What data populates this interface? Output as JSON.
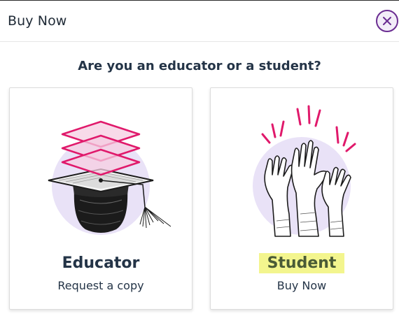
{
  "header": {
    "title": "Buy Now",
    "close_icon": "close-icon"
  },
  "question": "Are you an educator or a student?",
  "cards": [
    {
      "title": "Educator",
      "subtitle": "Request a copy",
      "icon": "graduation-cap-icon"
    },
    {
      "title": "Student",
      "subtitle": "Buy Now",
      "icon": "raised-hands-icon",
      "highlight_color": "#f3f58e"
    }
  ],
  "colors": {
    "brand_purple": "#6a2c91",
    "accent_pink": "#e0196b",
    "circle_lavender": "#e9e2f7",
    "text_dark": "#243447"
  }
}
